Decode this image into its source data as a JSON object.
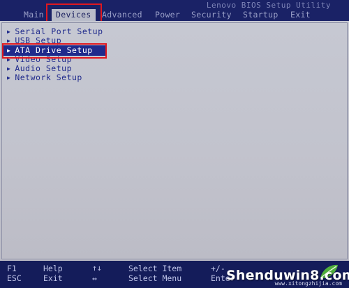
{
  "header": {
    "utility_title": "Lenovo BIOS Setup Utility",
    "menu": [
      {
        "label": "Main"
      },
      {
        "label": "Devices"
      },
      {
        "label": "Advanced"
      },
      {
        "label": "Power"
      },
      {
        "label": "Security"
      },
      {
        "label": "Startup"
      },
      {
        "label": "Exit"
      }
    ],
    "active_menu": "Devices"
  },
  "devices": {
    "items": [
      {
        "label": "Serial Port Setup"
      },
      {
        "label": "USB Setup"
      },
      {
        "label": "ATA Drive Setup"
      },
      {
        "label": "Video Setup"
      },
      {
        "label": "Audio Setup"
      },
      {
        "label": "Network Setup"
      }
    ],
    "selected": "ATA Drive Setup"
  },
  "footer": {
    "f1_key": "F1",
    "f1_label": "Help",
    "esc_key": "ESC",
    "esc_label": "Exit",
    "updown_key": "↑↓",
    "updown_label": "Select Item",
    "leftright_key": "↔",
    "leftright_label": "Select Menu",
    "plusminus_key": "+/-",
    "enter_key": "Enter"
  },
  "watermark": {
    "text": "Shenduwin8.com",
    "url": "www.xitongzhijia.com"
  },
  "colors": {
    "bios_blue": "#141c5a",
    "panel_gray": "#c6c8d2",
    "item_blue": "#1f2a8c",
    "highlight_red": "#e0171f"
  }
}
